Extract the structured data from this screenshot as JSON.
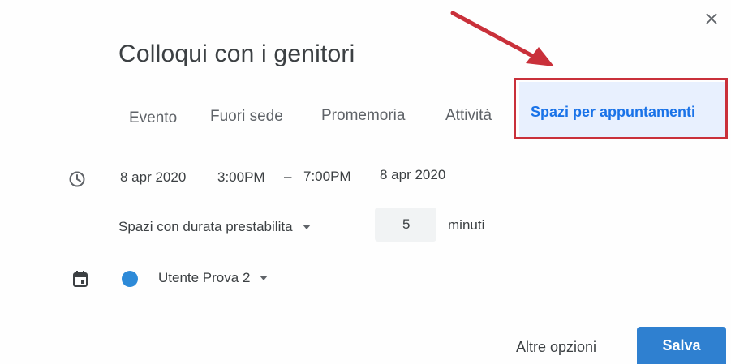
{
  "dialog": {
    "title": "Colloqui con i genitori",
    "close_label": "×"
  },
  "tabs": [
    {
      "label": "Evento",
      "active": false
    },
    {
      "label": "Fuori sede",
      "active": false
    },
    {
      "label": "Promemoria",
      "active": false
    },
    {
      "label": "Attività",
      "active": false
    },
    {
      "label": "Spazi per appuntamenti",
      "active": true
    }
  ],
  "time": {
    "start_date": "8 apr 2020",
    "start_time": "3:00PM",
    "separator": "–",
    "end_time": "7:00PM",
    "end_date": "8 apr 2020"
  },
  "slots": {
    "mode": "Spazi con durata prestabilita",
    "duration": "5",
    "unit": "minuti"
  },
  "calendar": {
    "name": "Utente Prova 2",
    "color": "#2d8ad8"
  },
  "footer": {
    "more_options": "Altre opzioni",
    "save": "Salva"
  },
  "colors": {
    "accent": "#1a73e8",
    "save_button": "#2f80d0",
    "annotation": "#c9303a"
  },
  "icons": {
    "close": "close-icon",
    "time": "clock-icon",
    "calendar": "calendar-icon",
    "dropdown": "caret-down-icon"
  }
}
